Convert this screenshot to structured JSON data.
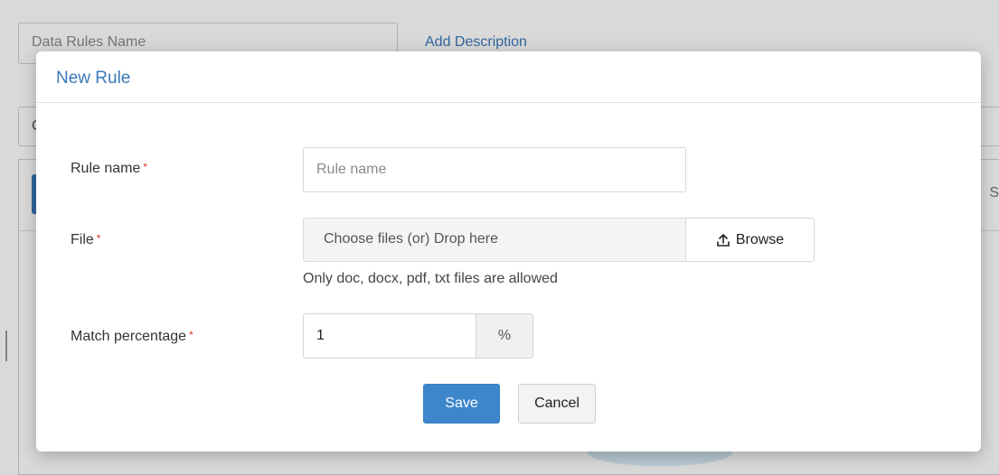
{
  "background": {
    "rules_name_placeholder": "Data Rules Name",
    "add_description_link": "Add Description",
    "second_row_char": "C",
    "right_edge_text": "S"
  },
  "modal": {
    "title": "New Rule",
    "rule_name": {
      "label": "Rule name",
      "required_marker": "*",
      "placeholder": "Rule name",
      "value": ""
    },
    "file": {
      "label": "File",
      "required_marker": "*",
      "drop_text": "Choose files (or) Drop here",
      "browse_label": "Browse",
      "browse_icon": "upload-icon",
      "hint": "Only doc, docx, pdf, txt files are allowed"
    },
    "match_percentage": {
      "label": "Match percentage",
      "required_marker": "*",
      "value": "1",
      "unit": "%"
    },
    "actions": {
      "save_label": "Save",
      "cancel_label": "Cancel"
    }
  },
  "colors": {
    "accent": "#3a78b8",
    "primary_button": "#3d86cc",
    "required": "#d9342b"
  }
}
